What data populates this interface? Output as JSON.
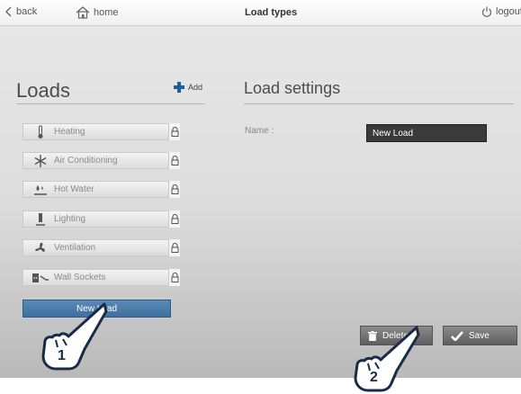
{
  "topbar": {
    "back_label": "back",
    "home_label": "home",
    "title": "Load types",
    "logout_label": "logout"
  },
  "loads": {
    "title": "Loads",
    "add_label": "Add",
    "items": [
      {
        "label": "Heating",
        "icon": "thermometer-icon"
      },
      {
        "label": "Air Conditioning",
        "icon": "snowflake-icon"
      },
      {
        "label": "Hot Water",
        "icon": "hot-water-icon"
      },
      {
        "label": "Lighting",
        "icon": "lamp-icon"
      },
      {
        "label": "Ventilation",
        "icon": "fan-icon"
      },
      {
        "label": "Wall Sockets",
        "icon": "socket-icon"
      }
    ],
    "new_item_label": "New Load"
  },
  "settings": {
    "title": "Load settings",
    "name_label": "Name :",
    "name_value": "New Load",
    "delete_label": "Delete",
    "save_label": "Save"
  },
  "annotations": {
    "step1": "1",
    "step2": "2"
  },
  "colors": {
    "selected_item": "#4a7aa7",
    "dark_field": "#3a3a3a",
    "button": "#6e6e6e",
    "add_plus": "#1f5f99"
  }
}
